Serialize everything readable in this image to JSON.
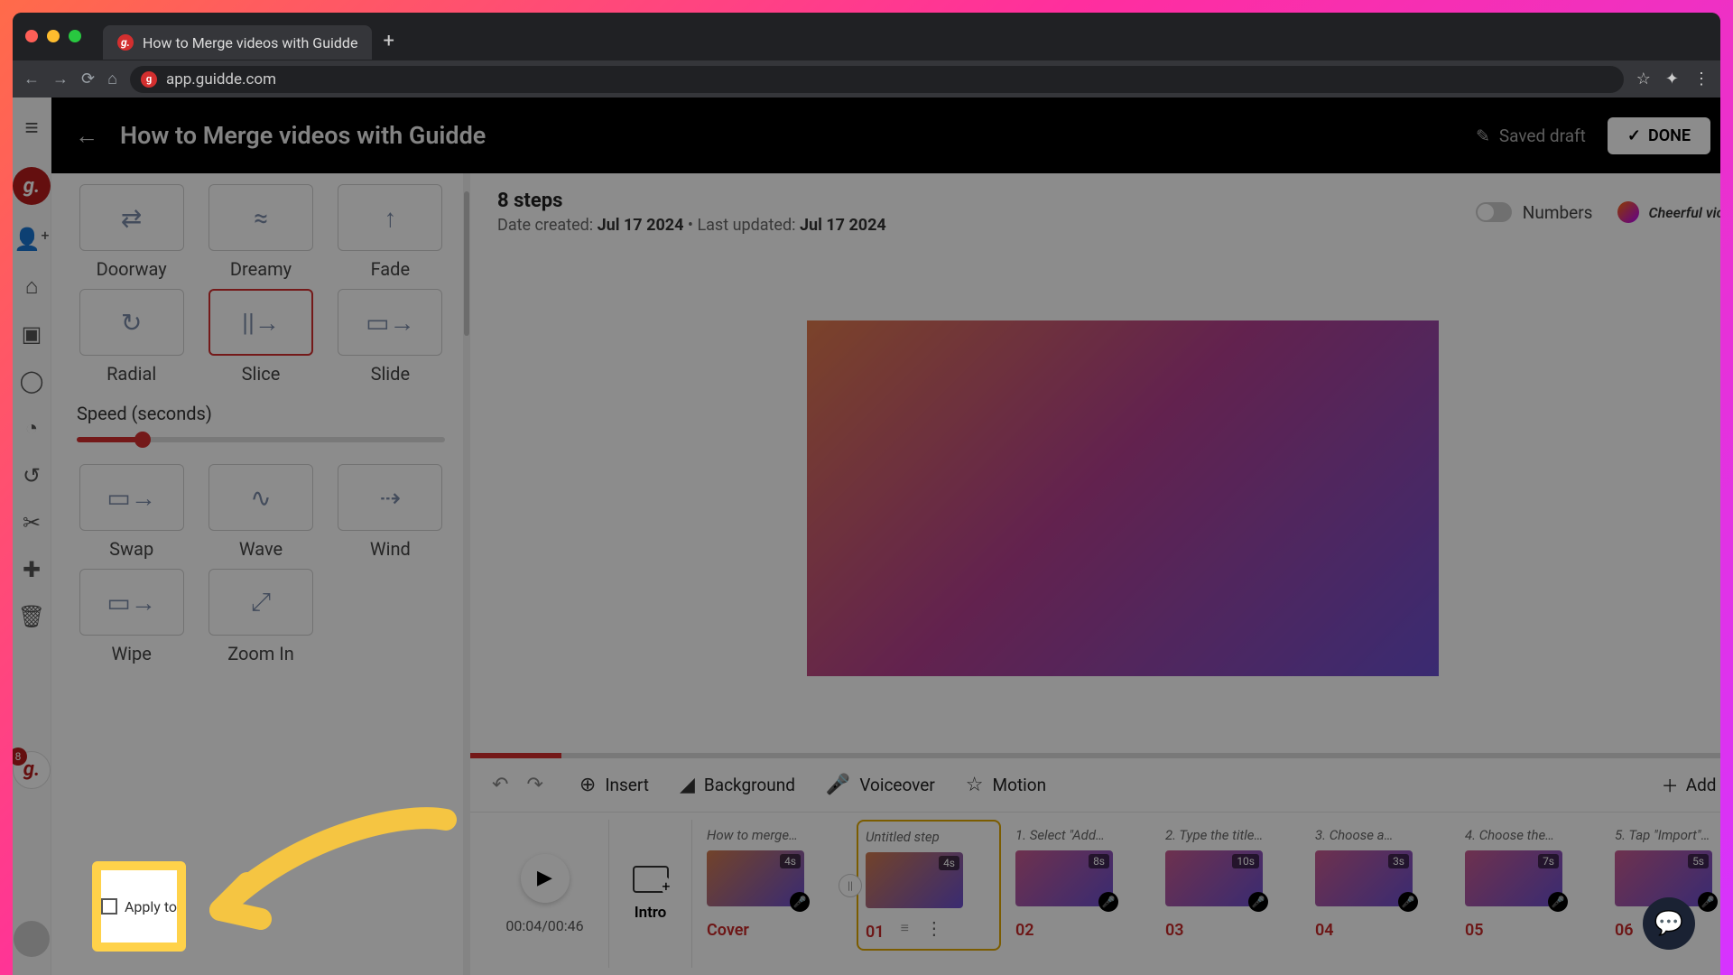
{
  "browser": {
    "tab_title": "How to Merge videos with Guidde",
    "url": "app.guidde.com"
  },
  "header": {
    "title": "How to Merge videos with Guidde",
    "saved_label": "Saved draft",
    "done_label": "DONE"
  },
  "meta": {
    "steps_count": "8 steps",
    "date_created_label": "Date created:",
    "date_created_value": "Jul 17 2024",
    "last_updated_label": "Last updated:",
    "last_updated_value": "Jul 17 2024",
    "numbers_label": "Numbers",
    "music_label": "Cheerful victory"
  },
  "transitions": {
    "row1": [
      "Doorway",
      "Dreamy",
      "Fade"
    ],
    "row2": [
      "Radial",
      "Slice",
      "Slide"
    ],
    "row3": [
      "Swap",
      "Wave",
      "Wind"
    ],
    "row4": [
      "Wipe",
      "Zoom In"
    ],
    "speed_label": "Speed (seconds)"
  },
  "toolbar": {
    "insert": "Insert",
    "background": "Background",
    "voiceover": "Voiceover",
    "motion": "Motion",
    "add_step": "Add step"
  },
  "play": {
    "time": "00:04/00:46",
    "intro_label": "Intro"
  },
  "steps": {
    "cover": {
      "title": "How to merge…",
      "dur": "4s",
      "num": "Cover"
    },
    "s01": {
      "title": "Untitled step",
      "dur": "4s",
      "num": "01"
    },
    "s02": {
      "title": "1. Select \"Add…",
      "dur": "8s",
      "num": "02"
    },
    "s03": {
      "title": "2. Type the title…",
      "dur": "10s",
      "num": "03"
    },
    "s04": {
      "title": "3. Choose a…",
      "dur": "3s",
      "num": "04"
    },
    "s05": {
      "title": "4. Choose the…",
      "dur": "7s",
      "num": "05"
    },
    "s06": {
      "title": "5. Tap \"Import\"…",
      "dur": "5s",
      "num": "06"
    }
  },
  "highlight": {
    "checkbox_label": "Apply to"
  },
  "rail_badge": "8"
}
